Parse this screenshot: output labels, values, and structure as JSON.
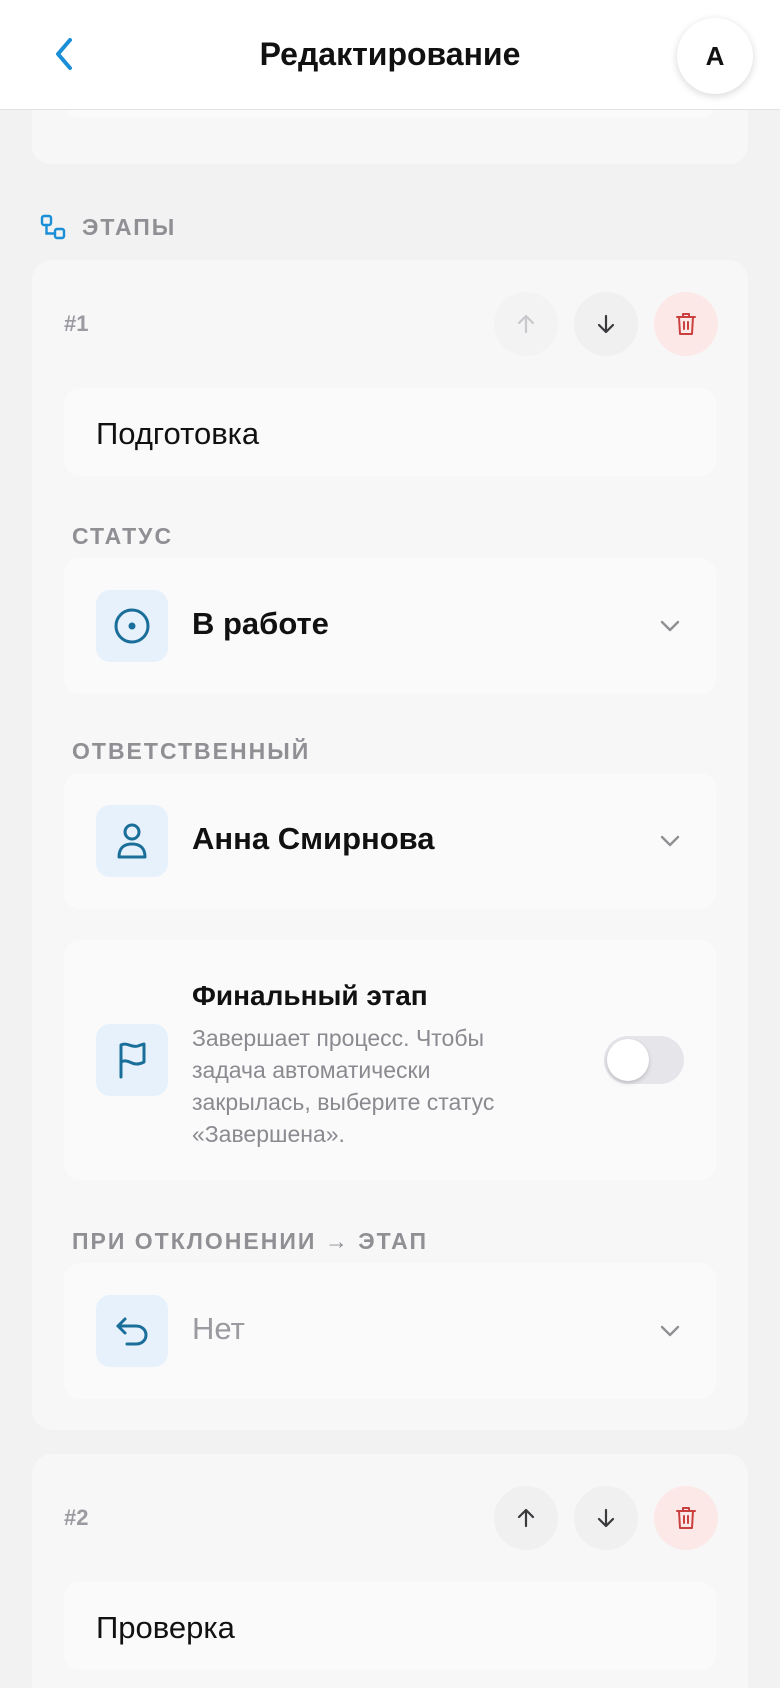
{
  "header": {
    "title": "Редактирование",
    "avatar_initial": "А"
  },
  "section": {
    "label": "ЭТАПЫ"
  },
  "stages": [
    {
      "number": "#1",
      "name": "Подготовка",
      "status_label": "СТАТУС",
      "status_value": "В работе",
      "assignee_label": "ОТВЕТСТВЕННЫЙ",
      "assignee_value": "Анна Смирнова",
      "final_title": "Финальный этап",
      "final_description": "Завершает процесс. Чтобы задача автоматически закрылась, выберите статус «Завершена».",
      "final_enabled": false,
      "reject_label": "ПРИ ОТКЛОНЕНИИ → ЭТАП",
      "reject_value": "Нет"
    },
    {
      "number": "#2",
      "name": "Проверка"
    }
  ],
  "colors": {
    "accent": "#1a8ed6",
    "icon_dark": "#1a6e9a",
    "delete": "#c9403f",
    "muted": "#8f8f94"
  },
  "icons": {
    "back": "chevron-left-icon",
    "stages": "flow-icon",
    "move_up": "arrow-up-icon",
    "move_down": "arrow-down-icon",
    "delete": "trash-icon",
    "status": "target-circle-icon",
    "assignee": "person-icon",
    "final": "flag-icon",
    "reject": "undo-arrow-icon",
    "dropdown": "chevron-down-icon"
  }
}
